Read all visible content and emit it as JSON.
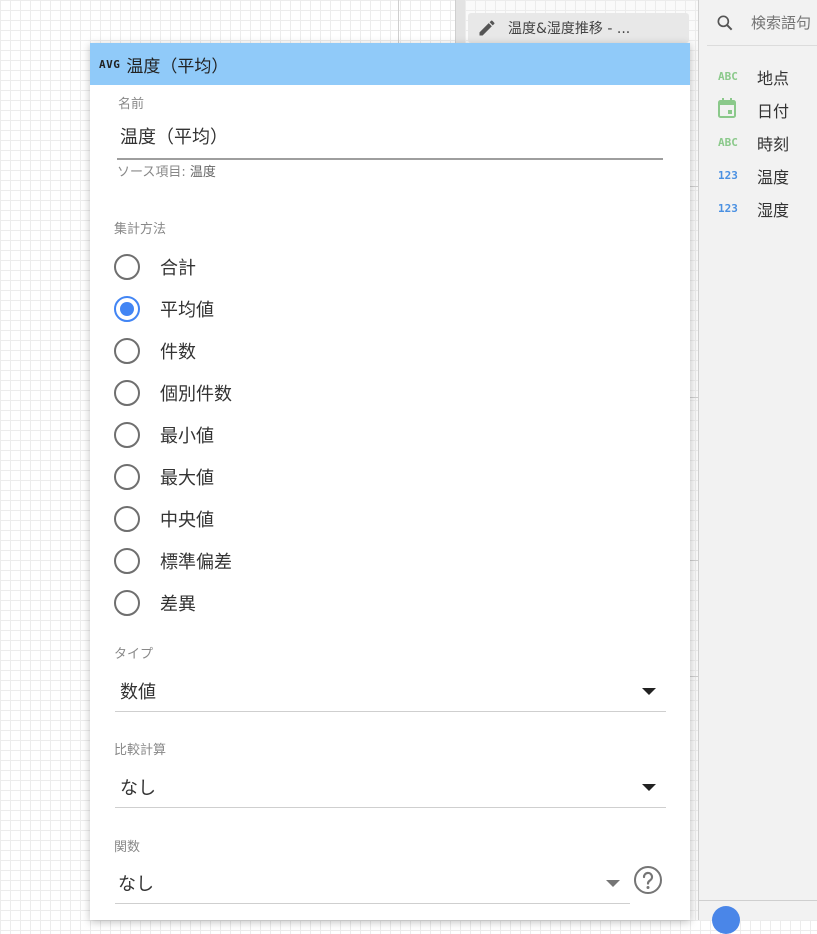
{
  "background": {
    "report_chip": {
      "label": "温度&湿度推移 - ...",
      "icon": "pencil-icon"
    }
  },
  "field_panel": {
    "search": {
      "placeholder": "検索語句"
    },
    "fields": [
      {
        "type": "ABC",
        "type_kind": "text",
        "name": "地点"
      },
      {
        "type": "date",
        "type_kind": "date",
        "name": "日付"
      },
      {
        "type": "ABC",
        "type_kind": "text",
        "name": "時刻"
      },
      {
        "type": "123",
        "type_kind": "number",
        "name": "温度"
      },
      {
        "type": "123",
        "type_kind": "number",
        "name": "湿度"
      }
    ]
  },
  "dialog": {
    "header": {
      "agg_badge": "AVG",
      "title": "温度（平均）"
    },
    "name": {
      "label": "名前",
      "value": "温度（平均）"
    },
    "source": {
      "label": "ソース項目:",
      "value": "温度"
    },
    "aggregation": {
      "label": "集計方法",
      "options": [
        "合計",
        "平均値",
        "件数",
        "個別件数",
        "最小値",
        "最大値",
        "中央値",
        "標準偏差",
        "差異"
      ],
      "selected": "平均値"
    },
    "type": {
      "label": "タイプ",
      "value": "数値"
    },
    "comparison": {
      "label": "比較計算",
      "value": "なし"
    },
    "function": {
      "label": "関数",
      "value": "なし"
    }
  },
  "colors": {
    "header_bg": "#90caf9",
    "radio_selected": "#4285f4",
    "type_text": "#8bc98b",
    "type_number": "#4a90e2"
  }
}
